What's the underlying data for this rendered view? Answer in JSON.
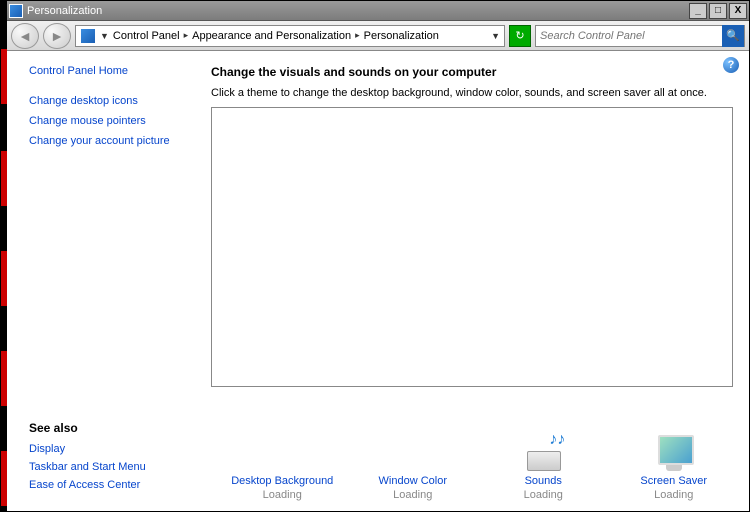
{
  "window": {
    "title": "Personalization"
  },
  "breadcrumb": {
    "seg1": "Control Panel",
    "seg2": "Appearance and Personalization",
    "seg3": "Personalization"
  },
  "search": {
    "placeholder": "Search Control Panel"
  },
  "sidebar": {
    "home": "Control Panel Home",
    "links": [
      "Change desktop icons",
      "Change mouse pointers",
      "Change your account picture"
    ]
  },
  "seealso": {
    "heading": "See also",
    "links": [
      "Display",
      "Taskbar and Start Menu",
      "Ease of Access Center"
    ]
  },
  "main": {
    "heading": "Change the visuals and sounds on your computer",
    "description": "Click a theme to change the desktop background, window color, sounds, and screen saver all at once."
  },
  "settings": [
    {
      "label": "Desktop Background",
      "status": "Loading"
    },
    {
      "label": "Window Color",
      "status": "Loading"
    },
    {
      "label": "Sounds",
      "status": "Loading"
    },
    {
      "label": "Screen Saver",
      "status": "Loading"
    }
  ]
}
